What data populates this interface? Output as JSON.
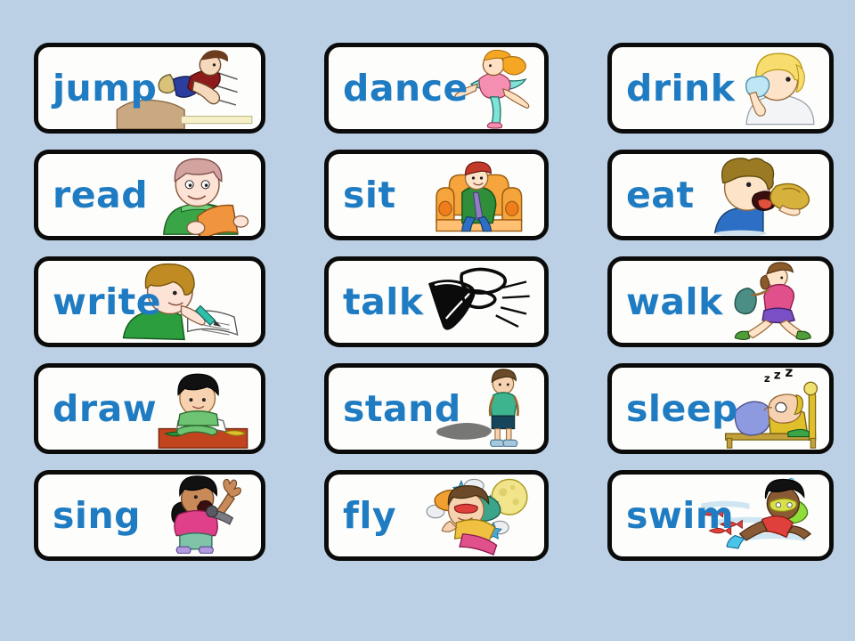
{
  "page": {
    "title": "Action Verbs Flashcards",
    "background_color": "#bcd0e5",
    "card_background_color": "#fdfdfb",
    "card_border_color": "#0b0b0b",
    "word_color": "#1f7cc2",
    "columns": 3,
    "rows": 5
  },
  "cards": [
    {
      "word": "jump",
      "illustration": "boy-long-jumping-into-sand-pit-icon"
    },
    {
      "word": "dance",
      "illustration": "ballerina-dancing-icon"
    },
    {
      "word": "drink",
      "illustration": "blond-boy-drinking-from-cup-icon"
    },
    {
      "word": "read",
      "illustration": "boy-reading-orange-book-icon"
    },
    {
      "word": "sit",
      "illustration": "man-sitting-in-orange-armchair-icon"
    },
    {
      "word": "eat",
      "illustration": "boy-eating-bread-icon"
    },
    {
      "word": "write",
      "illustration": "boy-writing-on-paper-icon"
    },
    {
      "word": "talk",
      "illustration": "talking-mouth-icon"
    },
    {
      "word": "walk",
      "illustration": "girl-walking-with-backpack-icon"
    },
    {
      "word": "draw",
      "illustration": "boy-drawing-with-crayons-icon"
    },
    {
      "word": "stand",
      "illustration": "boy-standing-with-shadow-icon"
    },
    {
      "word": "sleep",
      "illustration": "boy-sleeping-in-bed-zzz-icon"
    },
    {
      "word": "sing",
      "illustration": "girl-singing-into-microphone-icon"
    },
    {
      "word": "fly",
      "illustration": "girl-flying-in-space-icon"
    },
    {
      "word": "swim",
      "illustration": "boy-swimming-with-fish-icon"
    }
  ]
}
